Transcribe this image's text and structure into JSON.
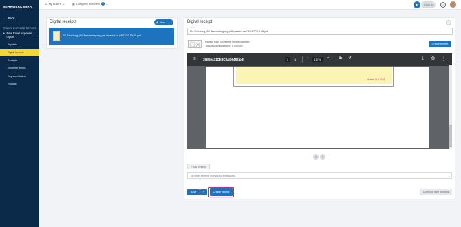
{
  "brand": {
    "logo": "MEHRWERK MIRA"
  },
  "topbar": {
    "my_to_do": "My to-do's",
    "company_overview": "Company overview",
    "company_count": "3",
    "clock_in": "Clock in"
  },
  "sidebar": {
    "back": "Back",
    "section_title": "TRAVEL EXPENSE REPORT",
    "group_label": "New travel expense report",
    "items": [
      {
        "label": "Trip data"
      },
      {
        "label": "Digital receipts"
      },
      {
        "label": "Receipts"
      },
      {
        "label": "Kilometer details"
      },
      {
        "label": "Day specification"
      },
      {
        "label": "Reports"
      }
    ]
  },
  "left_panel": {
    "title": "Digital receipts",
    "new_button": "New",
    "receipt_item": "PV-Schulung_AU-Bescheinigung.pdf created on 14/03/22 15:18.pdf"
  },
  "right_panel": {
    "title": "Digital receipt",
    "name_label": "Name",
    "name_value": "PV-Schulung_AU-Bescheinigung.pdf created on 14/03/22 15:18.pdf",
    "receipt_type": "Receipt type: No receipt field recognized",
    "total_gross": "Total gross pay amount: 0,00 EUR",
    "create_receipt_top": "Create receipt",
    "pdf": {
      "filename": "39E55431DE8C8AD6488.pdf",
      "page_current": "1",
      "page_sep": "/",
      "page_total": "1",
      "zoom": "117%",
      "stamp_text": "Muster 14.3.2018"
    },
    "add_receipt": "+ Add receipt",
    "linked_receipts_placeholder": "No other entered receipts for linking post",
    "save": "Save",
    "create_receipt_bottom": "Create receipt",
    "continue_with_receipts": "Continue with receipts"
  }
}
